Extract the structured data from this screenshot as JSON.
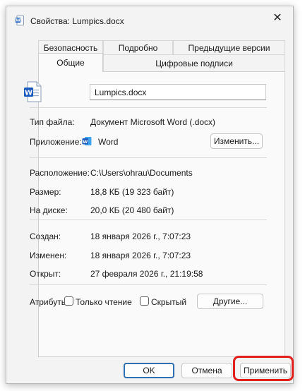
{
  "window": {
    "title": "Свойства: Lumpics.docx",
    "icon": "word-doc-icon",
    "close_glyph": "✕"
  },
  "tabs": {
    "row1": [
      "Безопасность",
      "Подробно",
      "Предыдущие версии"
    ],
    "row2": [
      "Общие",
      "Цифровые подписи"
    ],
    "active": "Общие"
  },
  "general": {
    "file_name": "Lumpics.docx",
    "file_type_label": "Тип файла:",
    "file_type_value": "Документ Microsoft Word (.docx)",
    "app_label": "Приложение:",
    "app_value": "Word",
    "change_button": "Изменить...",
    "location_label": "Расположение:",
    "location_value": "C:\\Users\\ohrau\\Documents",
    "size_label": "Размер:",
    "size_value": "18,8 КБ (19 323 байт)",
    "disk_label": "На диске:",
    "disk_value": "20,0 КБ (20 480 байт)",
    "created_label": "Создан:",
    "created_value": "18 января 2026 г., 7:07:23",
    "modified_label": "Изменен:",
    "modified_value": "18 января 2026 г., 7:07:23",
    "opened_label": "Открыт:",
    "opened_value": "27 февраля 2026 г., 21:19:58",
    "attributes_label": "Атрибуты:",
    "readonly_label": "Только чтение",
    "readonly_checked": false,
    "hidden_label": "Скрытый",
    "hidden_checked": false,
    "other_button": "Другие..."
  },
  "footer": {
    "ok": "OK",
    "cancel": "Отмена",
    "apply": "Применить"
  },
  "colors": {
    "word_blue": "#185abd",
    "highlight_red": "#e0201c",
    "ok_border": "#2f6fb3"
  }
}
